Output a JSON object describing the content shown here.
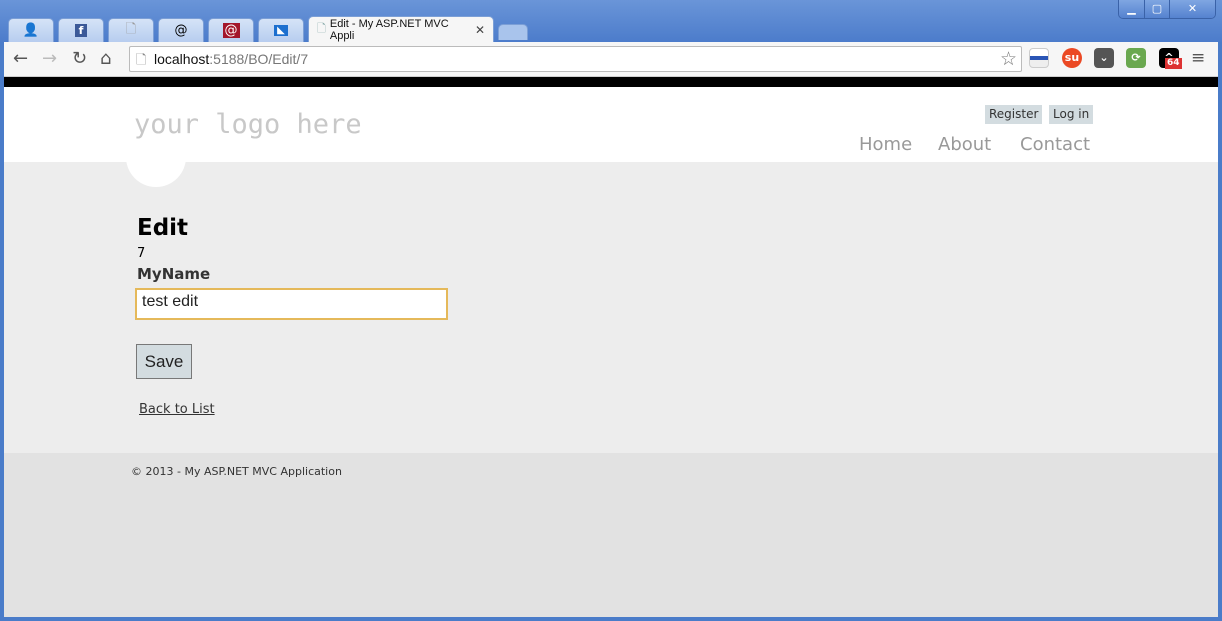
{
  "browser": {
    "tabs": [
      {
        "icon": "person-icon"
      },
      {
        "icon": "facebook-icon"
      },
      {
        "icon": "page-icon"
      },
      {
        "icon": "at-icon"
      },
      {
        "icon": "at-red-icon"
      },
      {
        "icon": "feed-icon"
      },
      {
        "title": "Edit - My ASP.NET MVC Appli",
        "active": true
      }
    ],
    "url_host": "localhost",
    "url_rest": ":5188/BO/Edit/7",
    "extension_badge": "64"
  },
  "site": {
    "logo": "your logo here",
    "register": "Register",
    "login": "Log in",
    "menu": [
      "Home",
      "About",
      "Contact"
    ]
  },
  "main": {
    "title": "Edit",
    "id_value": "7",
    "field_label": "MyName",
    "field_value": "test edit",
    "save_label": "Save",
    "back_link": "Back to List"
  },
  "footer": {
    "copyright": "© 2013 - My ASP.NET MVC Application"
  },
  "colors": {
    "accent_input_border": "#e5b95a",
    "button_bg": "#d3dce0",
    "page_bg": "#ededed",
    "footer_bg": "#e2e2e2"
  }
}
